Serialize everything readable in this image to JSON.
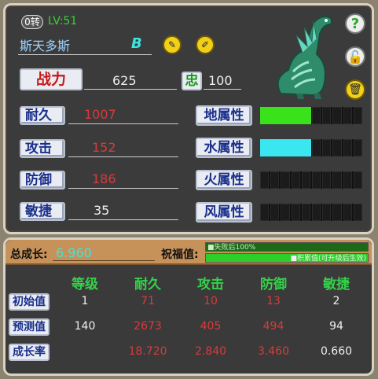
{
  "header": {
    "rebirth_badge": "0转",
    "level": "LV:51",
    "pet_name": "斯天多斯",
    "rank_letter": "B"
  },
  "power": {
    "label": "战力",
    "value": "625",
    "loyalty_label": "忠",
    "loyalty_value": "100"
  },
  "stats": [
    {
      "label": "耐久",
      "value": "1007",
      "color": "#d93a3a"
    },
    {
      "label": "攻击",
      "value": "152",
      "color": "#d93a3a"
    },
    {
      "label": "防御",
      "value": "186",
      "color": "#d93a3a"
    },
    {
      "label": "敏捷",
      "value": "35",
      "color": "#f0f0f0"
    }
  ],
  "attributes": [
    {
      "label": "地属性",
      "level": 0.5,
      "color": "#39e21b"
    },
    {
      "label": "水属性",
      "level": 0.5,
      "color": "#3ae6f0"
    },
    {
      "label": "火属性",
      "level": 0,
      "color": "#ff3b3b"
    },
    {
      "label": "风属性",
      "level": 0,
      "color": "#f0e33b"
    }
  ],
  "icons": {
    "help": "question-icon",
    "lock": "unlock-icon",
    "discard": "trash-icon",
    "edit_a": "edit-icon",
    "edit_b": "rename-icon"
  },
  "growth": {
    "total_label": "总成长:",
    "total_value": "6.960",
    "blessing_label": "祝福值:",
    "bar1_text": "■失败后100%",
    "bar2_text": "■积累值(可升级后生效)"
  },
  "table": {
    "columns": [
      "等级",
      "耐久",
      "攻击",
      "防御",
      "敏捷"
    ],
    "rows": [
      {
        "label": "初始值",
        "cells": [
          "1",
          "71",
          "10",
          "13",
          "2"
        ]
      },
      {
        "label": "预测值",
        "cells": [
          "140",
          "2673",
          "405",
          "494",
          "94"
        ]
      },
      {
        "label": "成长率",
        "cells": [
          "",
          "18.720",
          "2.840",
          "3.460",
          "0.660"
        ]
      }
    ]
  }
}
